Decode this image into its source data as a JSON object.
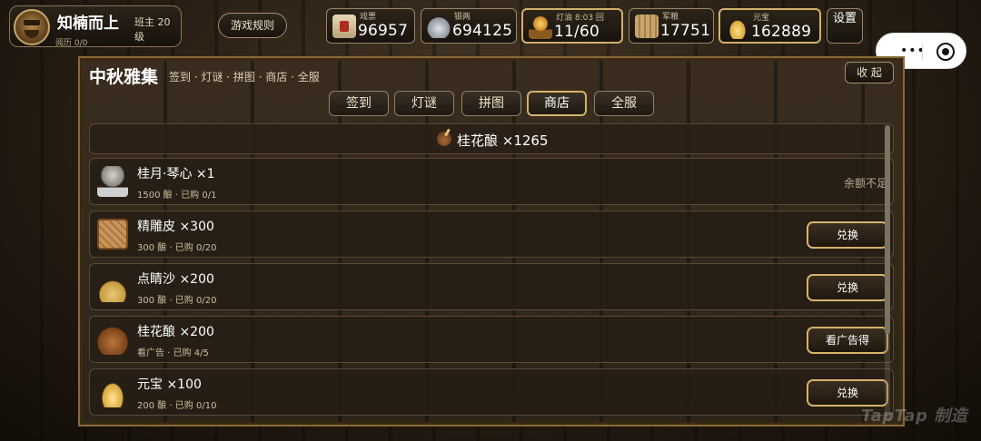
{
  "player": {
    "name": "知楠而上",
    "rank": "班主 20 级",
    "exp": "阅历 0/0"
  },
  "header": {
    "rules_label": "游戏规则",
    "settings_label": "设置",
    "resources": [
      {
        "label": "戏票",
        "value": "96957",
        "icon": "ticket-icon"
      },
      {
        "label": "银两",
        "value": "694125",
        "icon": "silver-icon"
      },
      {
        "label": "灯油 8:03 回",
        "value": "11/60",
        "icon": "lamp-icon"
      },
      {
        "label": "军粮",
        "value": "17751",
        "icon": "grain-icon"
      },
      {
        "label": "元宝",
        "value": "162889",
        "icon": "ingot-icon"
      }
    ]
  },
  "panel": {
    "title": "中秋雅集",
    "subtitle": "签到 · 灯谜 · 拼图 · 商店 · 全服",
    "collapse_label": "收 起",
    "tabs": [
      "签到",
      "灯谜",
      "拼图",
      "商店",
      "全服"
    ],
    "active_tab": "商店",
    "balance": "桂花酿 ×1265"
  },
  "shop": {
    "items": [
      {
        "name": "桂月·琴心 ×1",
        "meta": "1500 酿 · 已购 0/1",
        "action": "余额不足",
        "enabled": false,
        "icon": "lady-icon"
      },
      {
        "name": "精雕皮 ×300",
        "meta": "300 酿 · 已购 0/20",
        "action": "兑换",
        "enabled": true,
        "icon": "leather-icon"
      },
      {
        "name": "点睛沙 ×200",
        "meta": "300 酿 · 已购 0/20",
        "action": "兑换",
        "enabled": true,
        "icon": "sand-icon"
      },
      {
        "name": "桂花酿 ×200",
        "meta": "看广告 · 已购 4/5",
        "action": "看广告得",
        "enabled": true,
        "icon": "wine-jar-icon"
      },
      {
        "name": "元宝 ×100",
        "meta": "200 酿 · 已购 0/10",
        "action": "兑换",
        "enabled": true,
        "icon": "gold-ingot-icon"
      }
    ]
  },
  "watermark": "TapTap 制造",
  "colors": {
    "accent_gold": "#d6b36a",
    "panel_bg": "#2e2418",
    "text": "#f2e6cf"
  }
}
